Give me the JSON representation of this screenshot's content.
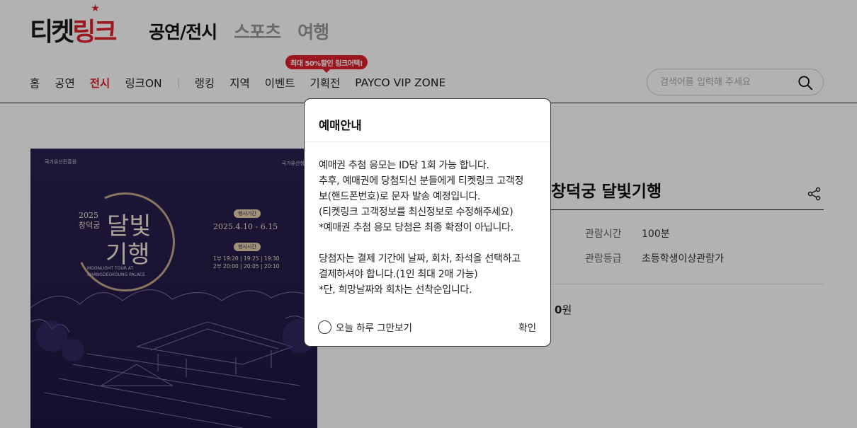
{
  "header": {
    "logo_part1": "티켓",
    "logo_part2": "링크",
    "top_nav": [
      {
        "label": "공연/전시",
        "active": true
      },
      {
        "label": "스포츠",
        "active": false
      },
      {
        "label": "여행",
        "active": false
      }
    ],
    "gnb_left": [
      "홈",
      "공연",
      "전시",
      "링크ON"
    ],
    "gnb_active": "전시",
    "gnb_right": [
      "랭킹",
      "지역",
      "이벤트",
      "기획전",
      "PAYCO VIP ZONE"
    ],
    "promo_badge": "최대 50%할인 링크어택!",
    "search_placeholder": "검색어를 입력해 주세요",
    "accent_color": "#e0202c"
  },
  "poster": {
    "org_left": "국가유산진흥원",
    "org_right": "국가유산청",
    "year": "2025",
    "place": "창덕궁",
    "title_line1": "달빛",
    "title_line2": "기행",
    "english": "MOONLIGHT TOUR AT CHANGDEOKGUNG PALACE",
    "period_tag": "행사기간",
    "period": "2025.4.10 - 6.15",
    "time_tag": "행사시간",
    "time_line1": "1부 19:20 | 19:25 | 19:30",
    "time_line2": "2부 20:00 | 20:05 | 20:10"
  },
  "detail": {
    "title": "창덕궁 달빛기행",
    "runtime_label": "관람시간",
    "runtime_value": "100분",
    "rating_label": "관람등급",
    "rating_value": "초등학생이상관람가",
    "price_partial": "0",
    "price_unit": "원"
  },
  "modal": {
    "title": "예매안내",
    "lines_block1": [
      "예매권 추첨 응모는 ID당 1회 가능 합니다.",
      "추후, 예매권에 당첨되신 분들에게 티켓링크 고객정",
      "보(핸드폰번호)로 문자 발송 예정입니다.",
      "(티켓링크 고객정보를 최신정보로 수정해주세요)",
      "*예매권 추첨 응모 당첨은 최종 확정이 아닙니다."
    ],
    "lines_block2": [
      "당첨자는 결제 기간에 날짜, 회차, 좌석을 선택하고",
      "결제하셔야 합니다.(1인 최대 2매 가능)",
      "*단, 희망날짜와 회차는 선착순입니다."
    ],
    "dont_show_today": "오늘 하루 그만보기",
    "confirm": "확인"
  }
}
